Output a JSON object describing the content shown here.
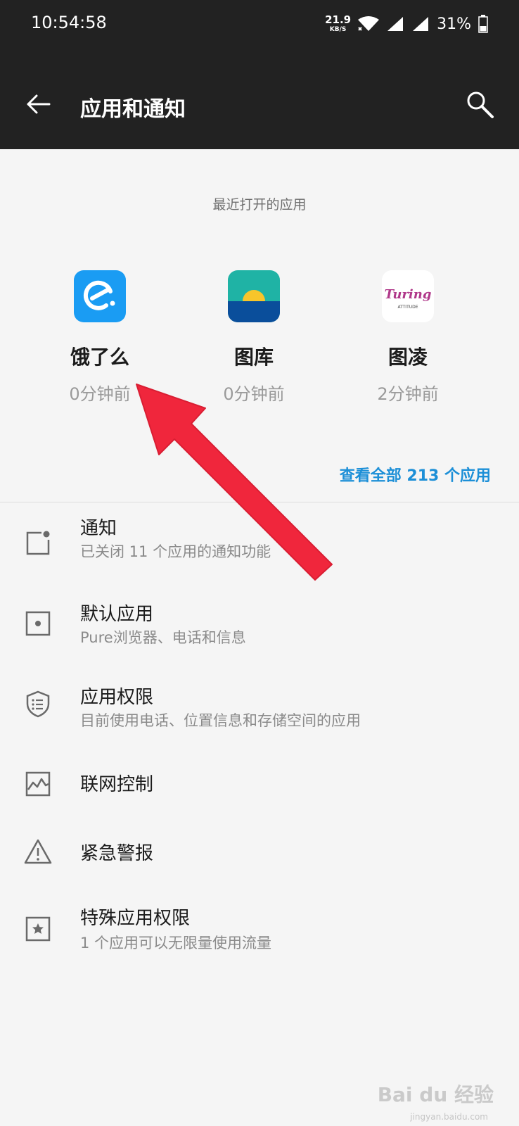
{
  "status_bar": {
    "time": "10:54:58",
    "net_speed_value": "21.9",
    "net_speed_unit": "KB/S",
    "battery": "31%"
  },
  "app_bar": {
    "title": "应用和通知",
    "back_icon": "arrow-left-icon",
    "search_icon": "search-icon"
  },
  "recent": {
    "label": "最近打开的应用",
    "apps": [
      {
        "name": "饿了么",
        "time": "0分钟前",
        "icon": "eleme-app-icon",
        "color": "#1a9cf3"
      },
      {
        "name": "图库",
        "time": "0分钟前",
        "icon": "gallery-app-icon",
        "color": "#0a4e9b"
      },
      {
        "name": "图凌",
        "time": "2分钟前",
        "icon": "turing-app-icon",
        "color": "#b0388a"
      }
    ],
    "view_all": "查看全部 213 个应用"
  },
  "settings": [
    {
      "title": "通知",
      "subtitle": "已关闭 11 个应用的通知功能",
      "icon": "notification-icon"
    },
    {
      "title": "默认应用",
      "subtitle": "Pure浏览器、电话和信息",
      "icon": "default-app-icon"
    },
    {
      "title": "应用权限",
      "subtitle": "目前使用电话、位置信息和存储空间的应用",
      "icon": "shield-icon"
    },
    {
      "title": "联网控制",
      "subtitle": "",
      "icon": "network-chart-icon"
    },
    {
      "title": "紧急警报",
      "subtitle": "",
      "icon": "warning-icon"
    },
    {
      "title": "特殊应用权限",
      "subtitle": "1 个应用可以无限量使用流量",
      "icon": "star-box-icon"
    }
  ],
  "turing_logo_text": "Turing",
  "turing_logo_sub": "ATTITUDE",
  "watermark": "Bai du 经验",
  "watermark_url": "jingyan.baidu.com",
  "colors": {
    "accent": "#1c8fd7",
    "arrow": "#f0263c",
    "appbar": "#222222"
  }
}
